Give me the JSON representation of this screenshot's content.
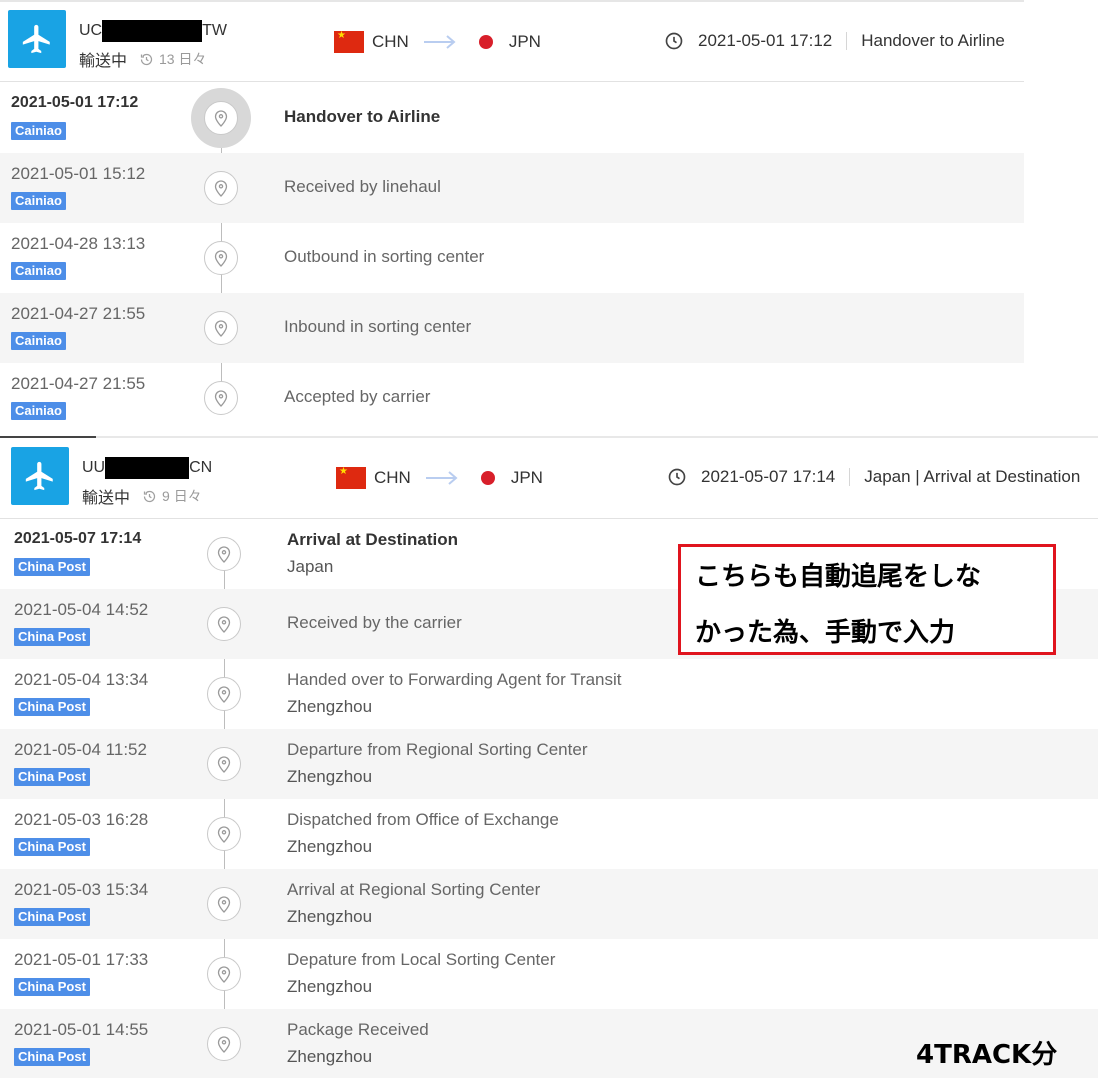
{
  "shipments": [
    {
      "tracking_prefix": "UC",
      "tracking_suffix": "TW",
      "status": "輸送中",
      "days": "13 日々",
      "origin": "CHN",
      "destination": "JPN",
      "last_time": "2021-05-01 17:12",
      "last_event": "Handover to Airline",
      "events": [
        {
          "time": "2021-05-01 17:12",
          "carrier": "Cainiao",
          "desc": "Handover to Airline",
          "location": ""
        },
        {
          "time": "2021-05-01 15:12",
          "carrier": "Cainiao",
          "desc": "Received by linehaul",
          "location": ""
        },
        {
          "time": "2021-04-28 13:13",
          "carrier": "Cainiao",
          "desc": "Outbound in sorting center",
          "location": ""
        },
        {
          "time": "2021-04-27 21:55",
          "carrier": "Cainiao",
          "desc": "Inbound in sorting center",
          "location": ""
        },
        {
          "time": "2021-04-27 21:55",
          "carrier": "Cainiao",
          "desc": "Accepted by carrier",
          "location": ""
        }
      ]
    },
    {
      "tracking_prefix": "UU",
      "tracking_suffix": "CN",
      "status": "輸送中",
      "days": "9 日々",
      "origin": "CHN",
      "destination": "JPN",
      "last_time": "2021-05-07 17:14",
      "last_event": "Japan | Arrival at Destination",
      "events": [
        {
          "time": "2021-05-07 17:14",
          "carrier": "China Post",
          "desc": "Arrival at Destination",
          "location": "Japan"
        },
        {
          "time": "2021-05-04 14:52",
          "carrier": "China Post",
          "desc": "Received by the carrier",
          "location": ""
        },
        {
          "time": "2021-05-04 13:34",
          "carrier": "China Post",
          "desc": "Handed over to Forwarding Agent for Transit",
          "location": "Zhengzhou"
        },
        {
          "time": "2021-05-04 11:52",
          "carrier": "China Post",
          "desc": "Departure from Regional Sorting Center",
          "location": "Zhengzhou"
        },
        {
          "time": "2021-05-03 16:28",
          "carrier": "China Post",
          "desc": "Dispatched from Office of Exchange",
          "location": "Zhengzhou"
        },
        {
          "time": "2021-05-03 15:34",
          "carrier": "China Post",
          "desc": "Arrival at Regional Sorting Center",
          "location": "Zhengzhou"
        },
        {
          "time": "2021-05-01 17:33",
          "carrier": "China Post",
          "desc": "Depature from Local Sorting Center",
          "location": "Zhengzhou"
        },
        {
          "time": "2021-05-01 14:55",
          "carrier": "China Post",
          "desc": "Package Received",
          "location": "Zhengzhou"
        }
      ]
    }
  ],
  "annotation": {
    "line1": "こちらも自動追尾をしな",
    "line2": "かった為、手動で入力"
  },
  "footer_tag": "4TRACK分",
  "colors": {
    "plane_box": "#19a3e4",
    "badge": "#4d8ee8",
    "note_border": "#e0141e",
    "jp_dot": "#d81f2a"
  },
  "icons": [
    "airplane-icon",
    "history-icon",
    "china-flag-icon",
    "arrow-right-icon",
    "japan-dot-icon",
    "clock-icon",
    "location-pin-icon"
  ]
}
